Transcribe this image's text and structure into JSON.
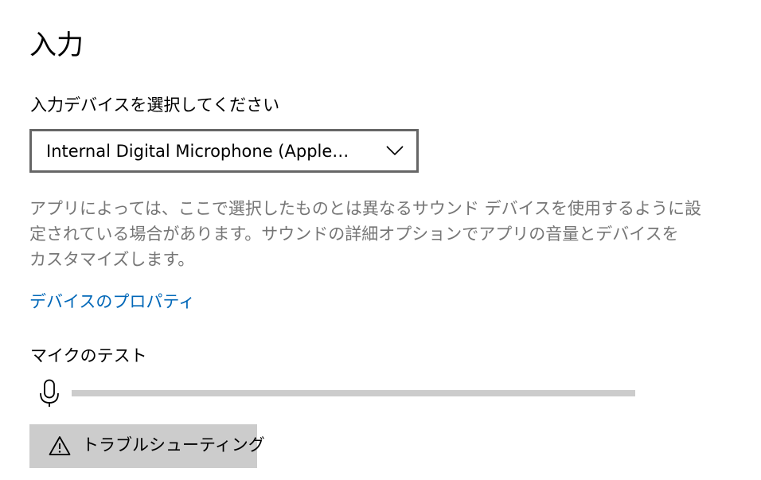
{
  "section": {
    "title": "入力"
  },
  "input_device": {
    "label": "入力デバイスを選択してください",
    "selected_value": "Internal Digital Microphone (Apple…"
  },
  "description": {
    "lines": [
      "アプリによっては、ここで選択したものとは異なるサウンド デバイスを使用するように設",
      "定されている場合があります。サウンドの詳細オプションでアプリの音量とデバイスを",
      "カスタマイズします。"
    ]
  },
  "device_properties_link": "デバイスのプロパティ",
  "mic_test": {
    "label": "マイクのテスト",
    "level": 0
  },
  "troubleshoot_button": {
    "label": "トラブルシューティング"
  },
  "colors": {
    "link": "#0067b8",
    "secondary_text": "#767676",
    "button_bg": "#cccccc",
    "track": "#cccccc",
    "dropdown_border": "#666666"
  },
  "icons": {
    "dropdown": "chevron-down-icon",
    "mic": "microphone-icon",
    "troubleshoot": "warning-icon"
  }
}
